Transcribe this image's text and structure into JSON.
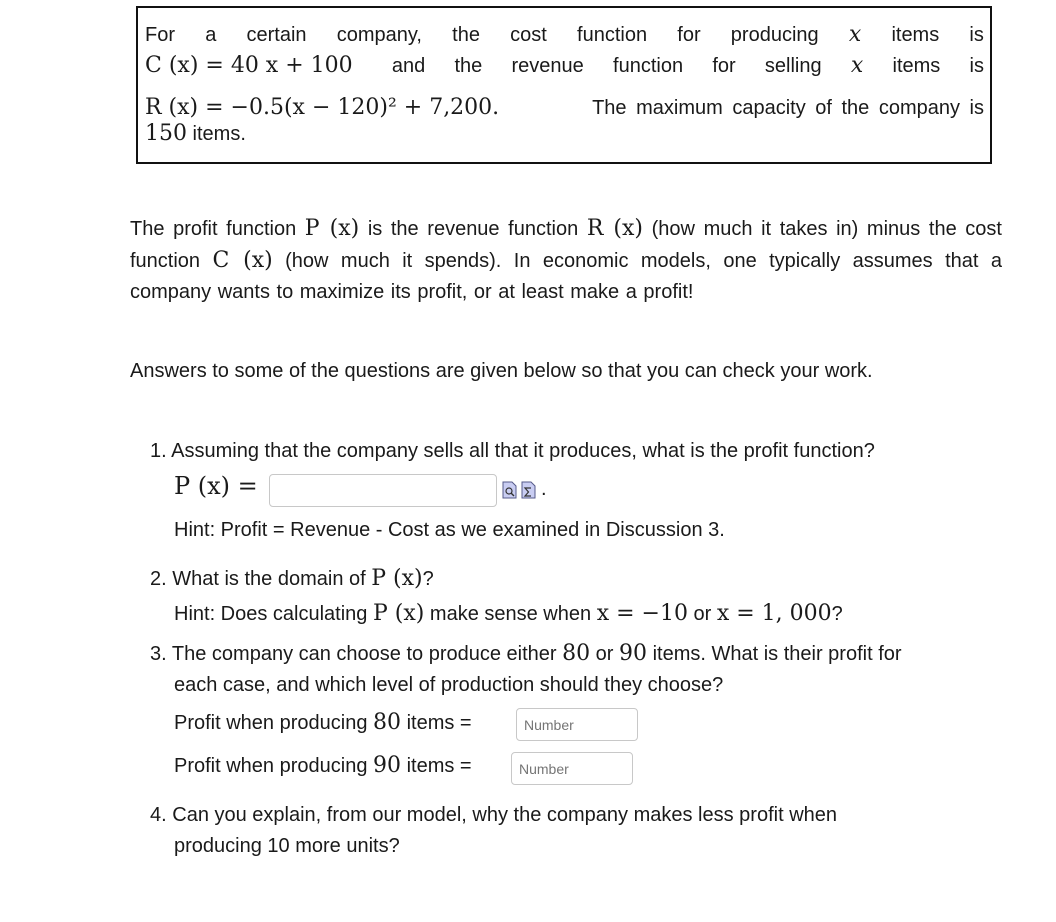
{
  "intro_box": {
    "line1": [
      "For",
      "a",
      "certain",
      "company,",
      "the",
      "cost",
      "function",
      "for",
      "producing",
      "x",
      "items",
      "is"
    ],
    "cost_fn": "C (x) = 40 x + 100",
    "line2_words": [
      "and",
      "the",
      "revenue",
      "function",
      "for",
      "selling",
      "x",
      "items",
      "is"
    ],
    "revenue_fn": "R (x) = −0.5(x − 120)² + 7,200.",
    "line3_text": "The maximum capacity of the company is",
    "line4_num": "150",
    "line4_text": " items."
  },
  "profit_paragraph": {
    "part1": "The profit function ",
    "p_of_x": "P (x)",
    "part2": " is the revenue function ",
    "r_of_x": "R (x)",
    "part3": " (how much it takes in)  minus the cost function ",
    "c_of_x": "C (x)",
    "part4": " (how much it spends). In economic models, one typically assumes that a company wants to maximize its profit, or at least make a profit!"
  },
  "answers_note": "Answers to some of the questions are given below so that you can check your work.",
  "questions": [
    {
      "number": "1.",
      "text": "Assuming that the company sells all that it produces, what is the profit function?",
      "answer_label": "P (x) =",
      "answer_value": "",
      "icons": [
        "preview-answer-icon",
        "equation-editor-icon"
      ],
      "trailing": ".",
      "hint": "Hint: Profit = Revenue - Cost as we examined in Discussion 3."
    },
    {
      "number": "2.",
      "text_before": "What is the domain of ",
      "math": "P (x)",
      "text_after": "?",
      "hint_before": "Hint: Does calculating ",
      "hint_math1": "P (x)",
      "hint_mid": " make sense when ",
      "hint_math2": "x = −10",
      "hint_or": " or ",
      "hint_math3": "x = 1, 000",
      "hint_end": "?"
    },
    {
      "number": "3.",
      "line1_before": "The company can choose to produce either ",
      "n1": "80",
      "line1_or": " or ",
      "n2": "90",
      "line1_after": " items. What is their profit for",
      "line2": "each case, and which level of production should they choose?",
      "answers": [
        {
          "label_before": "Profit when producing ",
          "n": "80",
          "label_after": " items =",
          "placeholder": "Number",
          "value": ""
        },
        {
          "label_before": "Profit when producing ",
          "n": "90",
          "label_after": " items =",
          "placeholder": "Number",
          "value": ""
        }
      ]
    },
    {
      "number": "4.",
      "line1": "Can you explain, from our model, why the company makes less profit when",
      "line2": "producing 10 more units?"
    }
  ]
}
